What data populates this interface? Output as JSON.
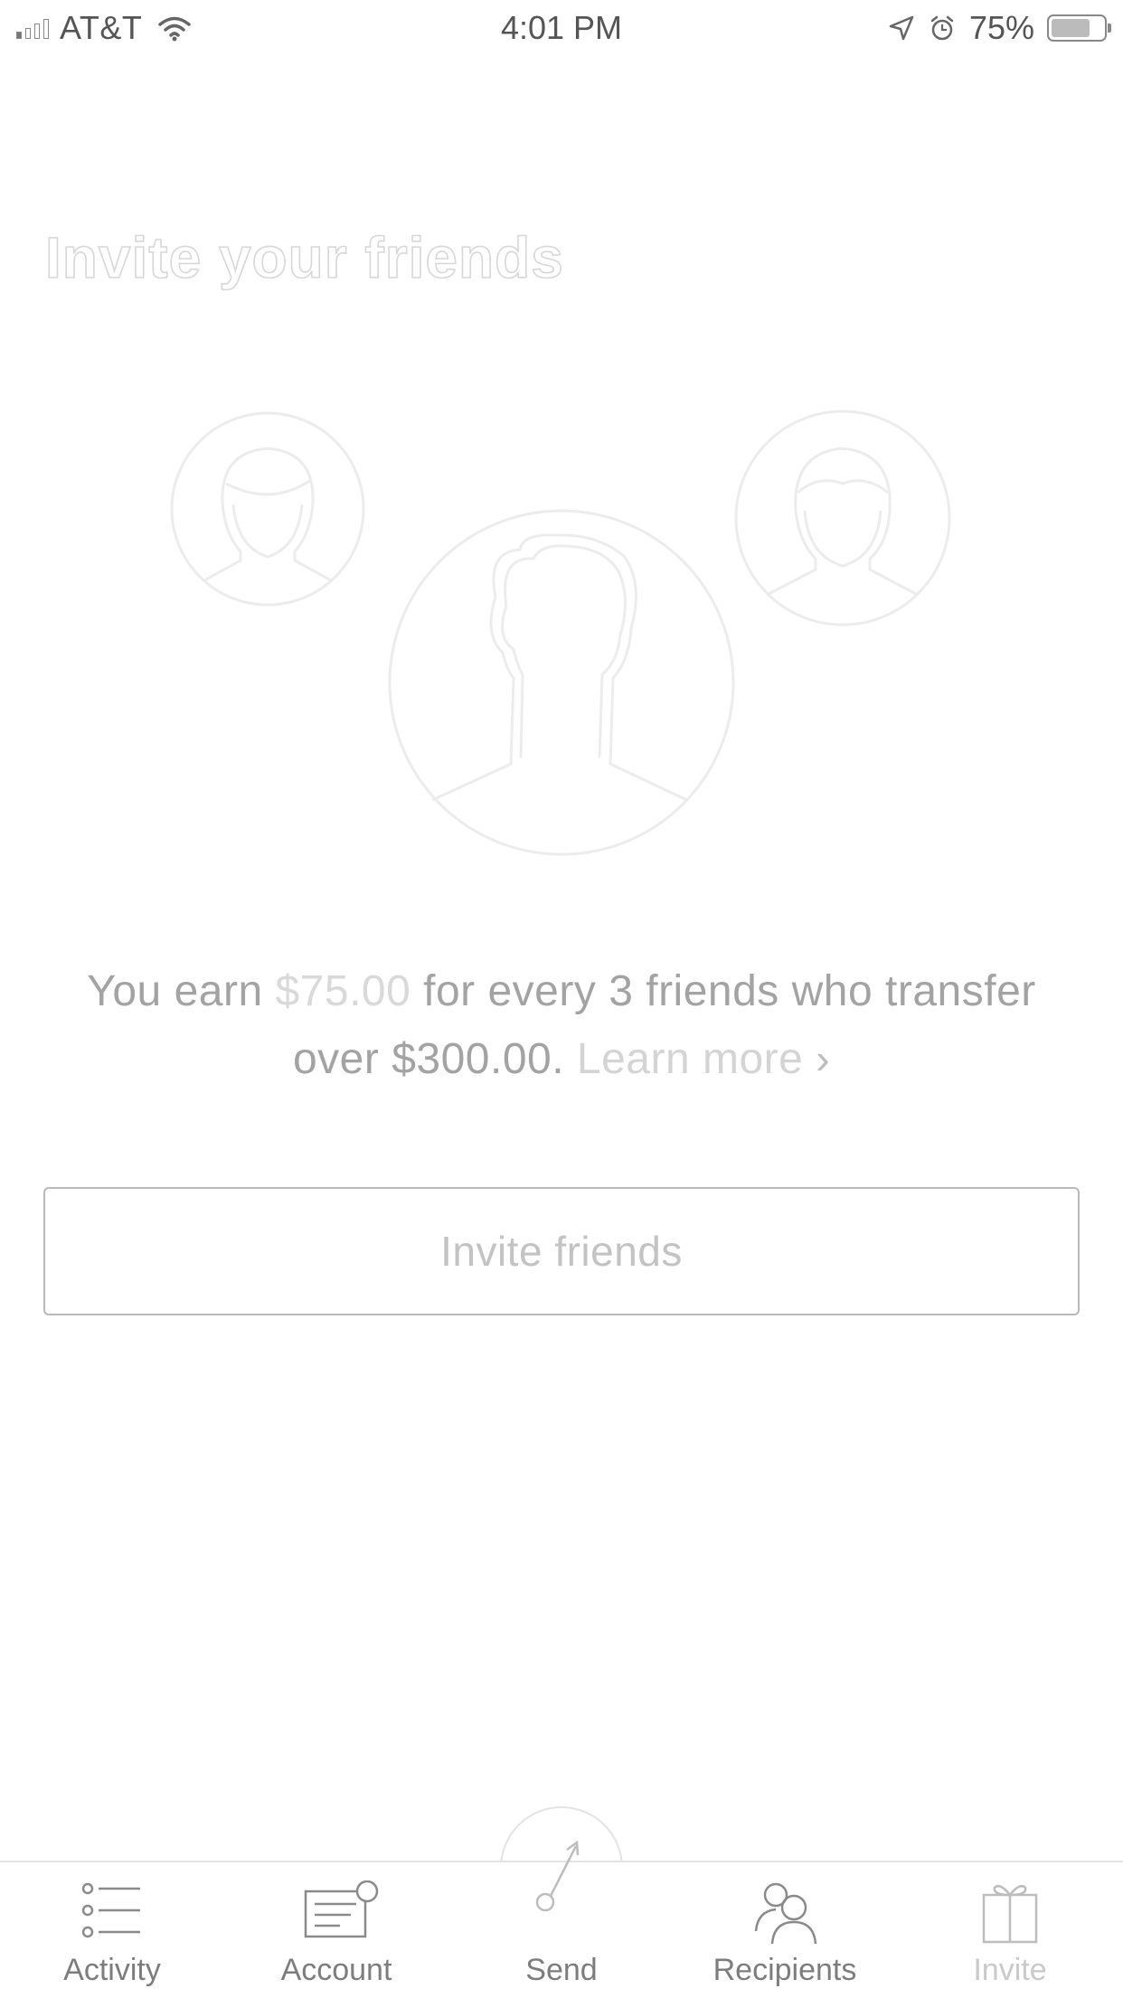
{
  "status_bar": {
    "carrier": "AT&T",
    "time": "4:01 PM",
    "battery": "75%",
    "battery_level": 0.75
  },
  "page": {
    "title": "Invite your friends"
  },
  "promo": {
    "part1": "You earn ",
    "amount": "$75.00",
    "part2": " for every 3 friends who transfer over $300.00. ",
    "learn_more": "Learn more",
    "chevron": "›"
  },
  "invite_button": {
    "label": "Invite friends"
  },
  "tabs": [
    {
      "label": "Activity",
      "icon": "list-icon"
    },
    {
      "label": "Account",
      "icon": "card-icon"
    },
    {
      "label": "Send",
      "icon": "send-arrow-icon"
    },
    {
      "label": "Recipients",
      "icon": "people-icon"
    },
    {
      "label": "Invite",
      "icon": "gift-icon",
      "active": true
    }
  ],
  "colors": {
    "text_muted": "#a3a3a3",
    "outline": "#d7d7d7",
    "button_border": "#b9b9b9"
  }
}
